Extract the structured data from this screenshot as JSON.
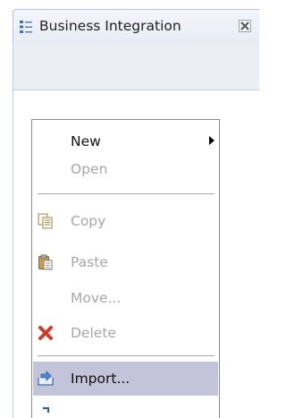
{
  "view": {
    "title": "Business Integration",
    "icon": "business-integration-tree-icon",
    "close_icon": "close-icon"
  },
  "context_menu": {
    "items": [
      {
        "label": "New",
        "enabled": true,
        "submenu": true
      },
      {
        "label": "Open",
        "enabled": false
      },
      {
        "label": "Copy",
        "enabled": false,
        "icon": "copy-icon"
      },
      {
        "label": "Paste",
        "enabled": false,
        "icon": "paste-icon"
      },
      {
        "label": "Move...",
        "enabled": false
      },
      {
        "label": "Delete",
        "enabled": false,
        "icon": "delete-icon"
      },
      {
        "label": "Import...",
        "enabled": true,
        "icon": "import-icon",
        "highlighted": true
      }
    ]
  },
  "colors": {
    "highlight": "#c3c3d9",
    "disabled_text": "#a6a6a6",
    "tab_background": "#e7ecf4"
  }
}
